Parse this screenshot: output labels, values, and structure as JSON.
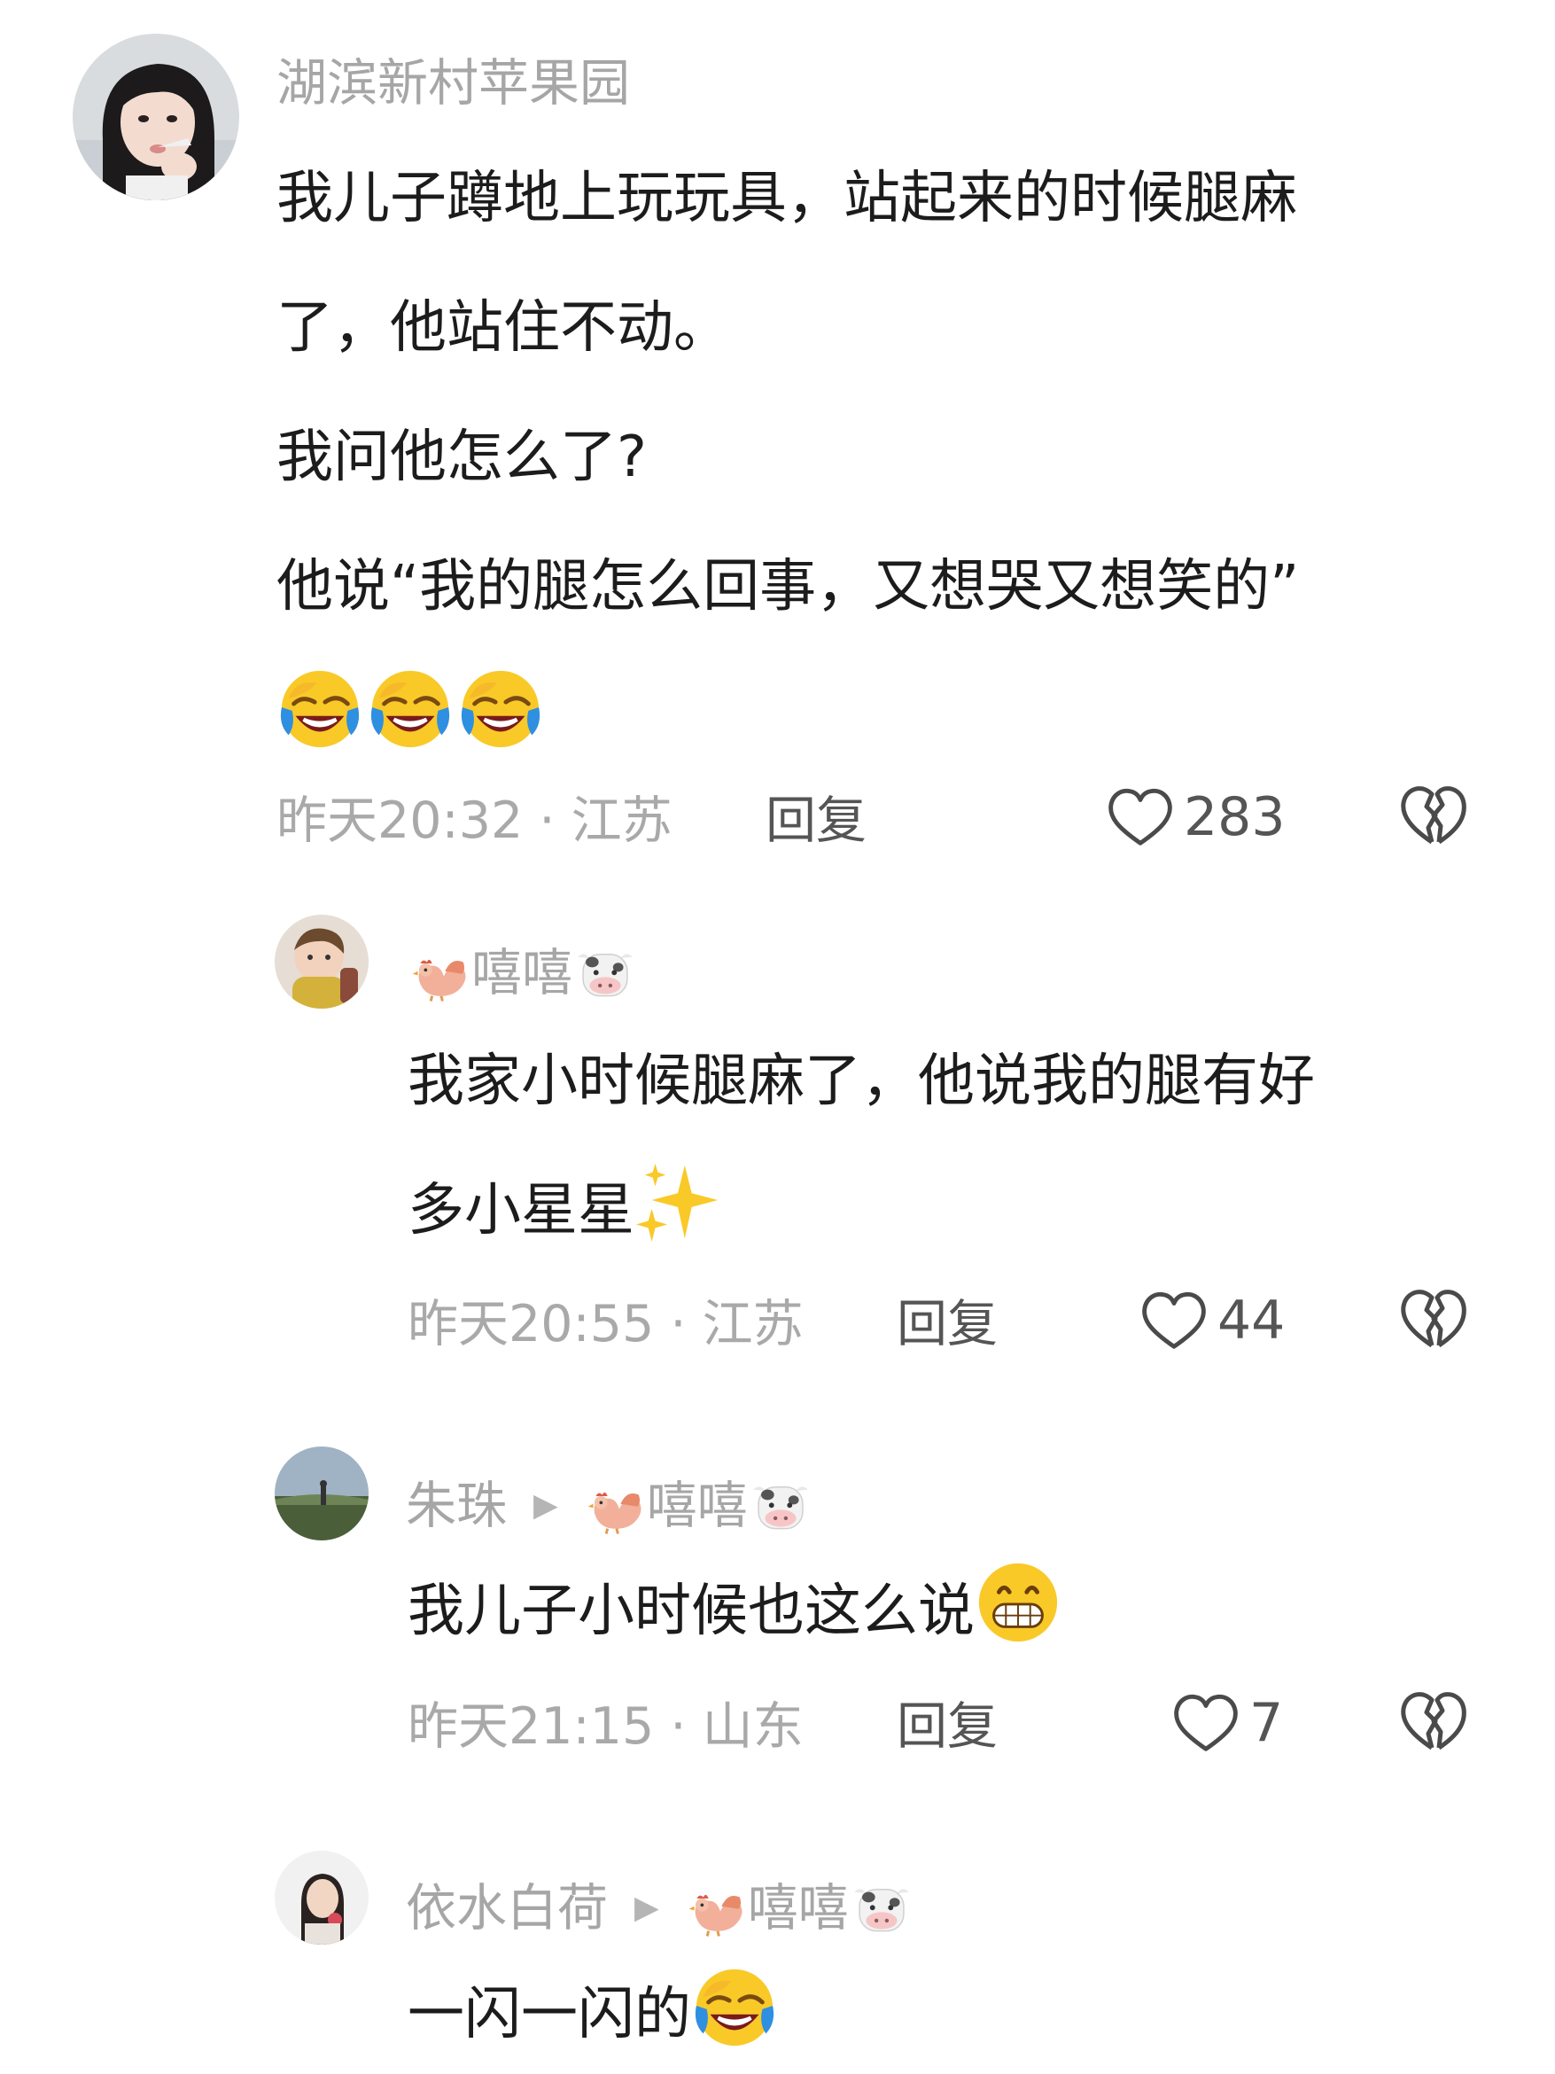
{
  "comments": [
    {
      "username": "湖滨新村苹果园",
      "lines": [
        "我儿子蹲地上玩玩具，站起来的时候腿麻",
        "了，他站住不动。",
        "我问他怎么了?",
        "他说“我的腿怎么回事，又想哭又想笑的”"
      ],
      "emojis": [
        "laugh-cry",
        "laugh-cry",
        "laugh-cry"
      ],
      "time": "昨天20:32 · 江苏",
      "reply": "回复",
      "likes": "283"
    },
    {
      "username": "嘻嘻",
      "username_prefix_icon": "rooster-icon",
      "username_suffix_icon": "cow-face-icon",
      "lines": [
        "我家小时候腿麻了，他说我的腿有好",
        "多小星星"
      ],
      "emojis": [
        "sparkles"
      ],
      "time": "昨天20:55 · 江苏",
      "reply": "回复",
      "likes": "44"
    },
    {
      "username": "朱珠",
      "reply_to": "嘻嘻",
      "lines": [
        "我儿子小时候也这么说"
      ],
      "emojis": [
        "grin"
      ],
      "time": "昨天21:15 · 山东",
      "reply": "回复",
      "likes": "7"
    },
    {
      "username": "依水白荷",
      "reply_to": "嘻嘻",
      "lines": [
        "一闪一闪的"
      ],
      "emojis": [
        "laugh-cry"
      ]
    }
  ],
  "colors": {
    "username": "#a6a6a6",
    "text": "#1c1c1c",
    "meta": "#a9a9a9",
    "action": "#555555",
    "emoji_yellow": "#f9c928",
    "emoji_blue": "#2f8fe0"
  }
}
